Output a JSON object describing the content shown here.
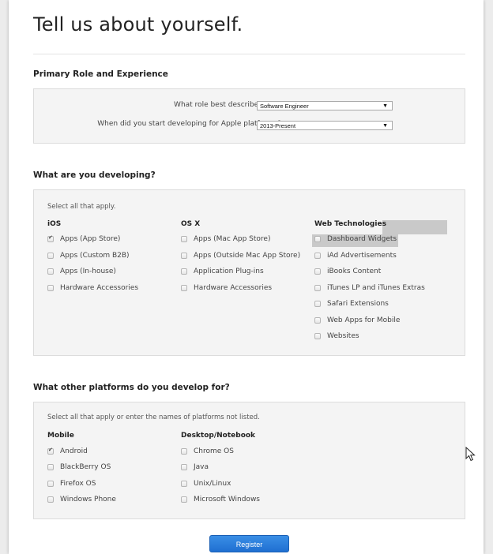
{
  "title": "Tell us about yourself.",
  "role_section": {
    "heading": "Primary Role and Experience",
    "role_label": "What role best describes you?",
    "role_value": "Software Engineer",
    "start_label": "When did you start developing for Apple platforms?",
    "start_value": "2013-Present"
  },
  "developing_section": {
    "heading": "What are you developing?",
    "hint": "Select all that apply.",
    "columns": [
      {
        "heading": "iOS",
        "items": [
          {
            "label": "Apps (App Store)",
            "checked": true
          },
          {
            "label": "Apps (Custom B2B)",
            "checked": false
          },
          {
            "label": "Apps (In-house)",
            "checked": false
          },
          {
            "label": "Hardware Accessories",
            "checked": false
          }
        ]
      },
      {
        "heading": "OS X",
        "items": [
          {
            "label": "Apps (Mac App Store)",
            "checked": false
          },
          {
            "label": "Apps (Outside Mac App Store)",
            "checked": false
          },
          {
            "label": "Application Plug-ins",
            "checked": false
          },
          {
            "label": "Hardware Accessories",
            "checked": false
          }
        ]
      },
      {
        "heading": "Web Technologies",
        "items": [
          {
            "label": "Dashboard Widgets",
            "checked": false
          },
          {
            "label": "iAd Advertisements",
            "checked": false
          },
          {
            "label": "iBooks Content",
            "checked": false
          },
          {
            "label": "iTunes LP and iTunes Extras",
            "checked": false
          },
          {
            "label": "Safari Extensions",
            "checked": false
          },
          {
            "label": "Web Apps for Mobile",
            "checked": false
          },
          {
            "label": "Websites",
            "checked": false
          }
        ]
      }
    ]
  },
  "platforms_section": {
    "heading": "What other platforms do you develop for?",
    "hint": "Select all that apply or enter the names of platforms not listed.",
    "columns": [
      {
        "heading": "Mobile",
        "items": [
          {
            "label": "Android",
            "checked": true
          },
          {
            "label": "BlackBerry OS",
            "checked": false
          },
          {
            "label": "Firefox OS",
            "checked": false
          },
          {
            "label": "Windows Phone",
            "checked": false
          }
        ]
      },
      {
        "heading": "Desktop/Notebook",
        "items": [
          {
            "label": "Chrome OS",
            "checked": false
          },
          {
            "label": "Java",
            "checked": false
          },
          {
            "label": "Unix/Linux",
            "checked": false
          },
          {
            "label": "Microsoft Windows",
            "checked": false
          }
        ]
      }
    ]
  },
  "register_label": "Register",
  "icons": {
    "cursor": "mouse-pointer-icon",
    "dropdown": "triangle-down-icon",
    "checkmark": "check-icon"
  }
}
